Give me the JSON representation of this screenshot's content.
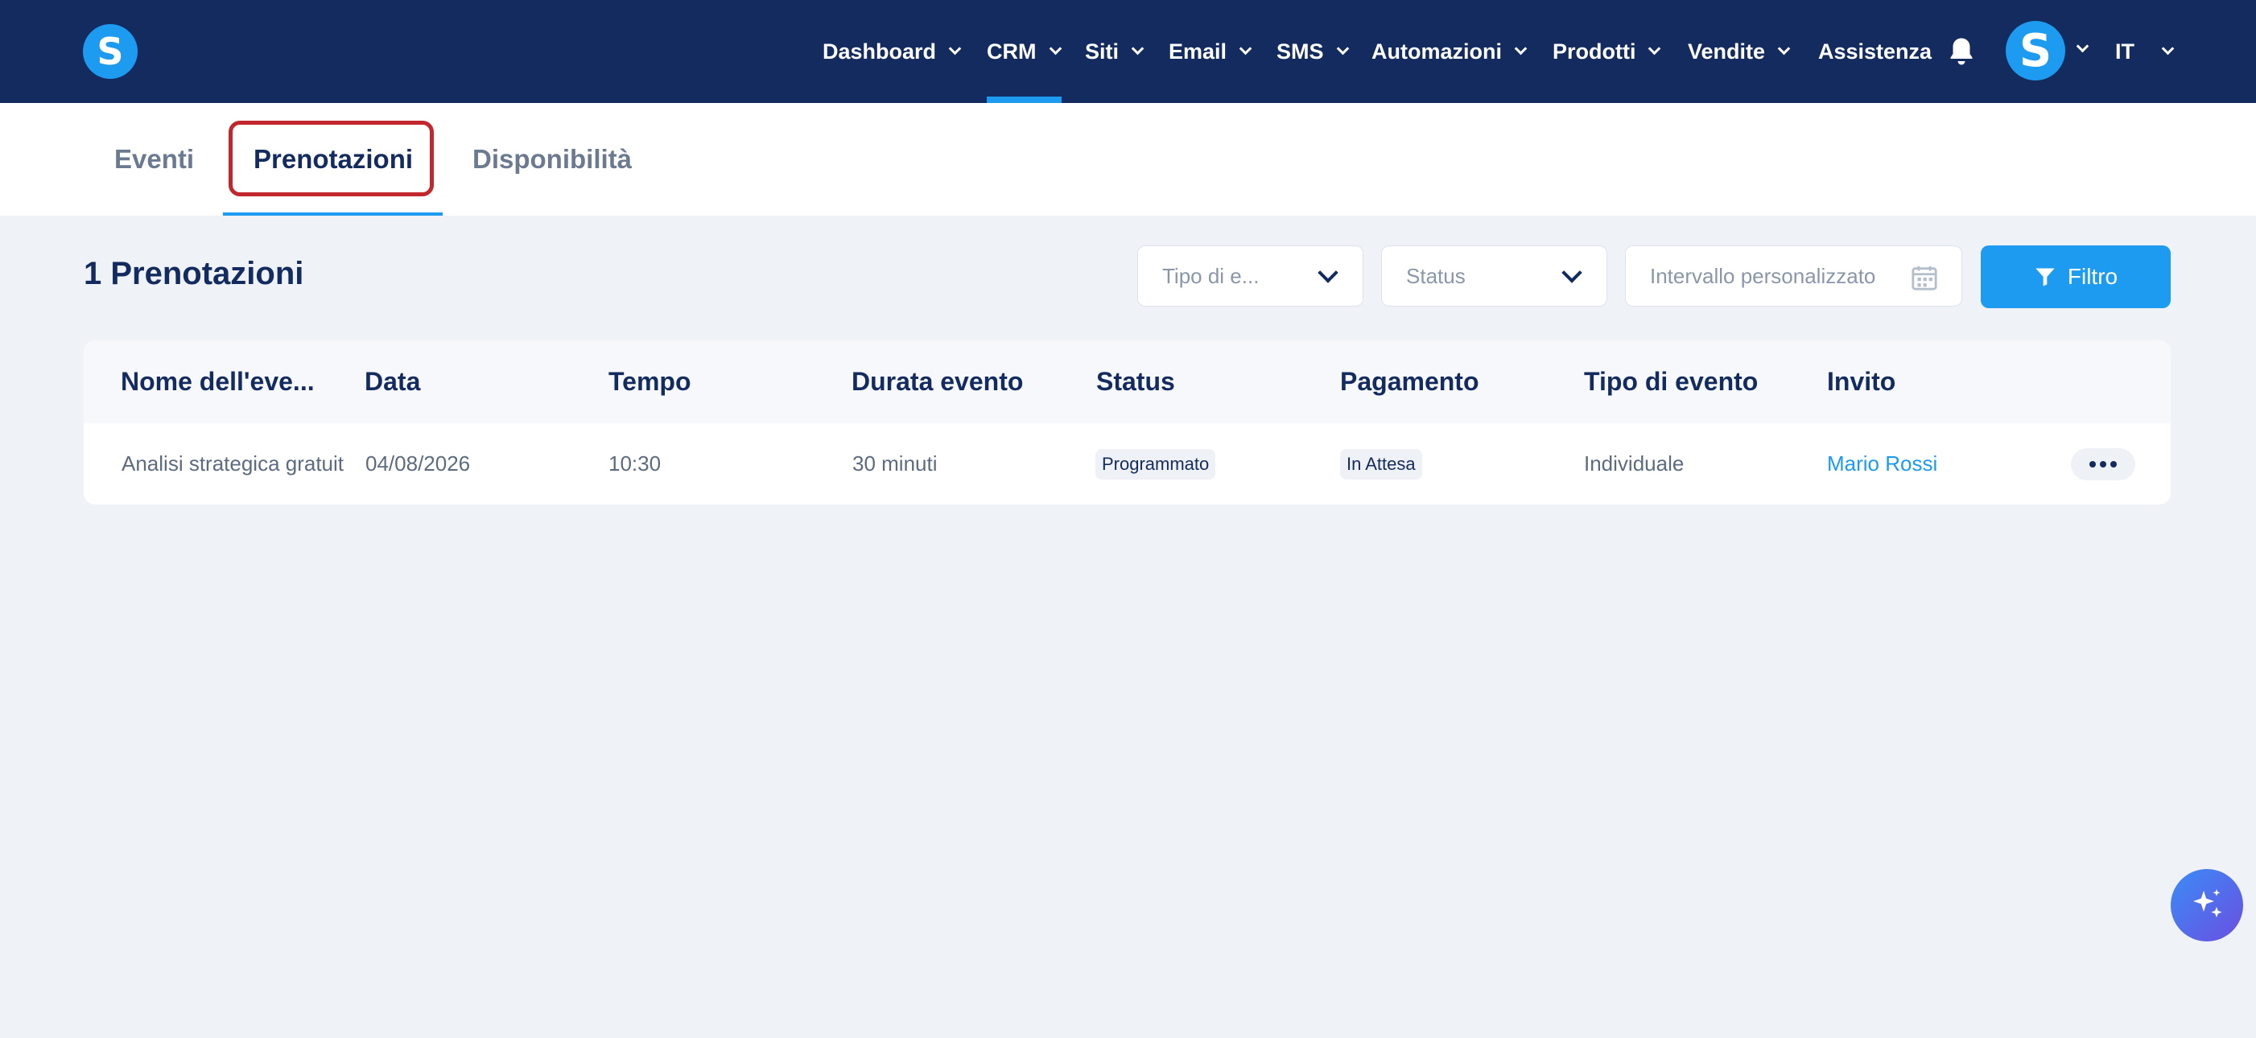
{
  "app": {
    "logo_letter": "S",
    "avatar_letter": "S"
  },
  "nav": {
    "items": [
      {
        "label": "Dashboard"
      },
      {
        "label": "CRM"
      },
      {
        "label": "Siti"
      },
      {
        "label": "Email"
      },
      {
        "label": "SMS"
      },
      {
        "label": "Automazioni"
      },
      {
        "label": "Prodotti"
      },
      {
        "label": "Vendite"
      },
      {
        "label": "Assistenza"
      }
    ],
    "active": "CRM",
    "language": "IT"
  },
  "subtabs": {
    "items": [
      {
        "label": "Eventi"
      },
      {
        "label": "Prenotazioni"
      },
      {
        "label": "Disponibilità"
      }
    ],
    "active": "Prenotazioni"
  },
  "page": {
    "heading": "1 Prenotazioni"
  },
  "filters": {
    "event_type_placeholder": "Tipo di e...",
    "status_placeholder": "Status",
    "date_range_placeholder": "Intervallo personalizzato",
    "filter_button": "Filtro"
  },
  "table": {
    "columns": [
      "Nome dell'eve...",
      "Data",
      "Tempo",
      "Durata evento",
      "Status",
      "Pagamento",
      "Tipo di evento",
      "Invito"
    ],
    "rows": [
      {
        "name": "Analisi strategica gratuita",
        "date": "04/08/2026",
        "time": "10:30",
        "duration": "30 minuti",
        "status": "Programmato",
        "payment": "In Attesa",
        "event_type": "Individuale",
        "invitee": "Mario Rossi"
      }
    ]
  },
  "colors": {
    "navbar": "#132b5e",
    "accent": "#1c9bf0",
    "background": "#eff3f8",
    "highlight": "#c1272d"
  },
  "icons": [
    "bell-icon",
    "chevron-down-icon",
    "funnel-icon",
    "calendar-icon",
    "more-icon",
    "sparkle-icon"
  ]
}
